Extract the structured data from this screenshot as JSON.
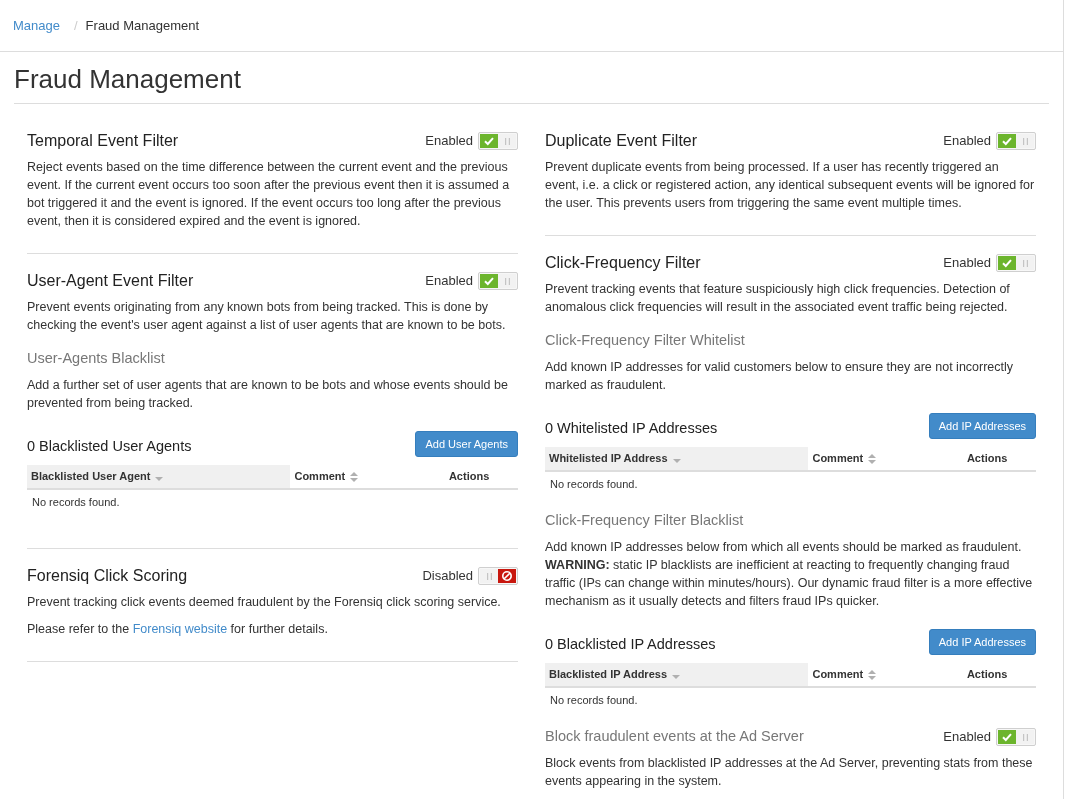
{
  "breadcrumb": {
    "items": [
      {
        "label": "Manage",
        "kind": "link"
      },
      {
        "label": "Fraud Management",
        "kind": "current"
      }
    ],
    "separator": "/"
  },
  "page_title": "Fraud Management",
  "columns": [
    {
      "sections": [
        {
          "title": "Temporal Event Filter",
          "status": {
            "label": "Enabled",
            "on": true
          },
          "blocks": [
            {
              "kind": "paragraph",
              "text": "Reject events based on the time difference between the current event and the previous event. If the current event occurs too soon after the previous event then it is assumed a bot triggered it and the event is ignored. If the event occurs too long after the previous event, then it is considered expired and the event is ignored."
            }
          ]
        },
        {
          "title": "User-Agent Event Filter",
          "status": {
            "label": "Enabled",
            "on": true
          },
          "blocks": [
            {
              "kind": "paragraph",
              "text": "Prevent events originating from any known bots from being tracked. This is done by checking the event's user agent against a list of user agents that are known to be bots."
            },
            {
              "kind": "subheading",
              "text": "User-Agents Blacklist"
            },
            {
              "kind": "paragraph",
              "text": "Add a further set of user agents that are known to be bots and whose events should be prevented from being tracked."
            },
            {
              "kind": "table",
              "heading": "0 Blacklisted User Agents",
              "button": "Add User Agents",
              "columns": [
                {
                  "label": "Blacklisted User Agent",
                  "sortable": true,
                  "sorted": true
                },
                {
                  "label": "Comment",
                  "sortable": true,
                  "sorted": false
                },
                {
                  "label": "Actions"
                }
              ],
              "empty_text": "No records found."
            }
          ]
        },
        {
          "title": "Forensiq Click Scoring",
          "status": {
            "label": "Disabled",
            "on": false
          },
          "blocks": [
            {
              "kind": "paragraph",
              "text": "Prevent tracking click events deemed fraudulent by the Forensiq click scoring service."
            },
            {
              "kind": "link_paragraph",
              "before": "Please refer to the ",
              "link": "Forensiq website",
              "after": " for further details."
            }
          ]
        }
      ]
    },
    {
      "sections": [
        {
          "title": "Duplicate Event Filter",
          "status": {
            "label": "Enabled",
            "on": true
          },
          "blocks": [
            {
              "kind": "paragraph",
              "text": "Prevent duplicate events from being processed. If a user has recently triggered an event, i.e. a click or registered action, any identical subsequent events will be ignored for the user. This prevents users from triggering the same event multiple times."
            }
          ]
        },
        {
          "title": "Click-Frequency Filter",
          "status": {
            "label": "Enabled",
            "on": true
          },
          "blocks": [
            {
              "kind": "paragraph",
              "text": "Prevent tracking events that feature suspiciously high click frequencies. Detection of anomalous click frequencies will result in the associated event traffic being rejected."
            },
            {
              "kind": "subheading",
              "text": "Click-Frequency Filter Whitelist"
            },
            {
              "kind": "paragraph",
              "text": "Add known IP addresses for valid customers below to ensure they are not incorrectly marked as fraudulent."
            },
            {
              "kind": "table",
              "heading": "0 Whitelisted IP Addresses",
              "button": "Add IP Addresses",
              "columns": [
                {
                  "label": "Whitelisted IP Address",
                  "sortable": true,
                  "sorted": true
                },
                {
                  "label": "Comment",
                  "sortable": true,
                  "sorted": false
                },
                {
                  "label": "Actions"
                }
              ],
              "empty_text": "No records found."
            },
            {
              "kind": "subheading",
              "text": "Click-Frequency Filter Blacklist"
            },
            {
              "kind": "paragraph",
              "text": "Add known IP addresses below from which all events should be marked as fraudulent. **WARNING:** static IP blacklists are inefficient at reacting to frequently changing fraud traffic (IPs can change within minutes/hours). Our dynamic fraud filter is a more effective mechanism as it usually detects and filters fraud IPs quicker."
            },
            {
              "kind": "table",
              "heading": "0 Blacklisted IP Addresses",
              "button": "Add IP Addresses",
              "columns": [
                {
                  "label": "Blacklisted IP Address",
                  "sortable": true,
                  "sorted": true
                },
                {
                  "label": "Comment",
                  "sortable": true,
                  "sorted": false
                },
                {
                  "label": "Actions"
                }
              ],
              "empty_text": "No records found."
            },
            {
              "kind": "subheading",
              "text": "Block fraudulent events at the Ad Server",
              "status": {
                "label": "Enabled",
                "on": true
              }
            },
            {
              "kind": "paragraph",
              "text": "Block events from blacklisted IP addresses at the Ad Server, preventing stats from these events appearing in the system."
            }
          ]
        }
      ]
    }
  ]
}
